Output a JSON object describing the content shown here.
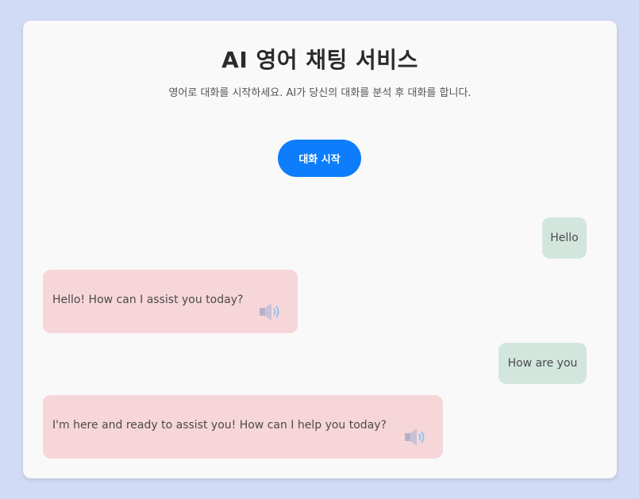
{
  "header": {
    "title": "AI 영어 채팅 서비스",
    "subtitle": "영어로 대화를 시작하세요. AI가 당신의 대화를 분석 후 대화를 합니다."
  },
  "controls": {
    "start_label": "대화 시작"
  },
  "messages": [
    {
      "role": "user",
      "text": "Hello"
    },
    {
      "role": "ai",
      "text": "Hello! How can I assist you today?",
      "icon": "speaker-icon"
    },
    {
      "role": "user",
      "text": "How are you"
    },
    {
      "role": "ai",
      "text": "I'm here and ready to assist you! How can I help you today?",
      "icon": "speaker-icon"
    }
  ],
  "colors": {
    "background": "#d2dbf5",
    "card": "#f9f9f9",
    "accent": "#0d7dfb",
    "user_bubble": "#d3e6dd",
    "ai_bubble": "#f7d6d9"
  }
}
